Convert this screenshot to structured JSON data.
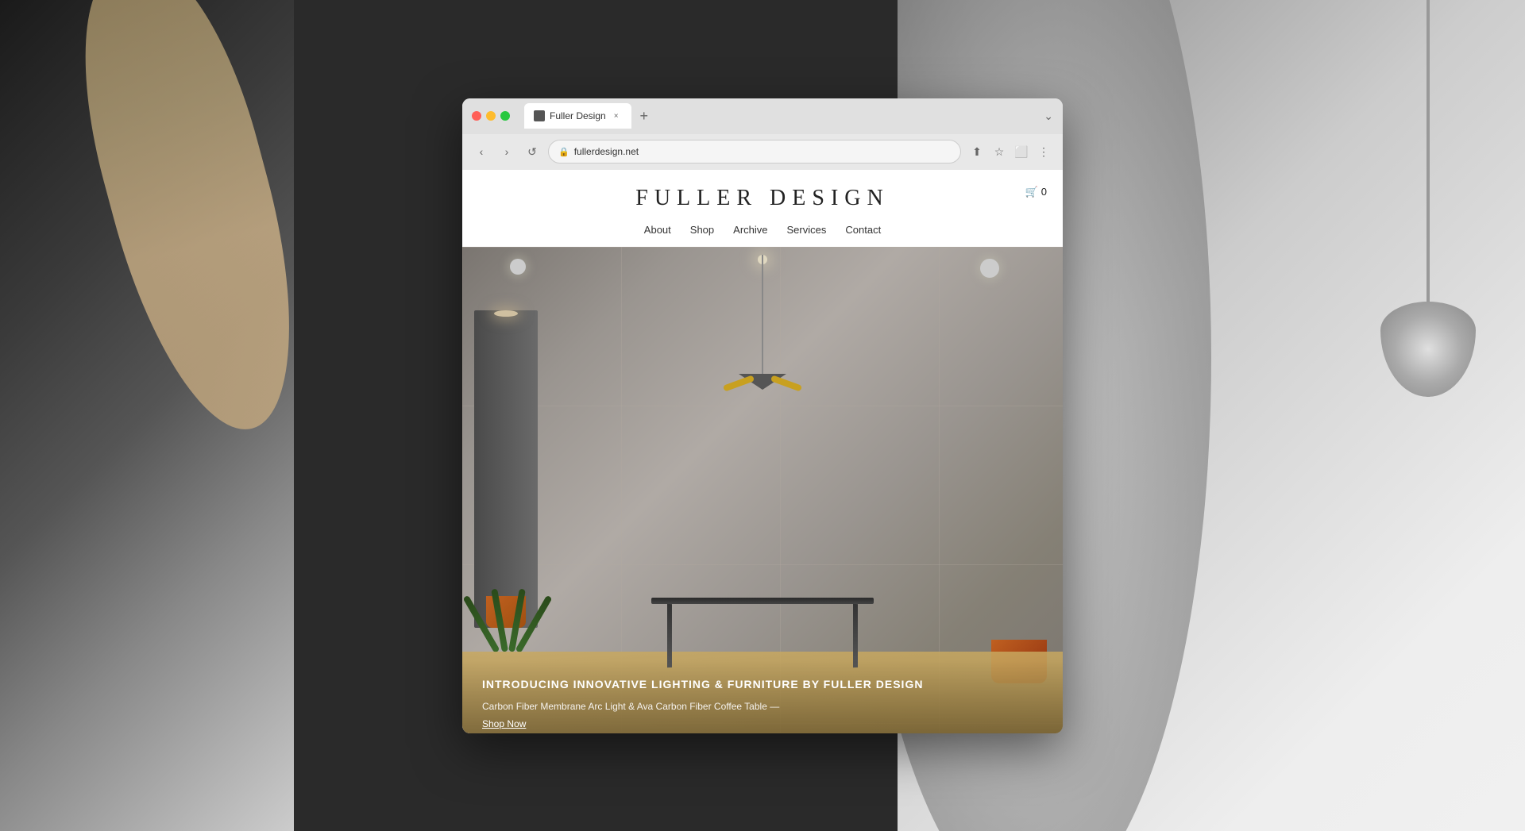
{
  "browser": {
    "tab_title": "Fuller Design",
    "tab_favicon": "F",
    "url": "fullerdesign.net",
    "tab_close": "×",
    "tab_new": "+",
    "tab_dropdown": "⌄",
    "nav_back": "‹",
    "nav_forward": "›",
    "nav_refresh": "↺",
    "nav_share": "⬆",
    "nav_bookmark": "☆",
    "nav_sidebar": "⬜",
    "nav_more": "⋮",
    "cart_count": "0"
  },
  "site": {
    "logo": "FULLER DESIGN",
    "nav": {
      "about": "About",
      "shop": "Shop",
      "archive": "Archive",
      "services": "Services",
      "contact": "Contact"
    },
    "cart_icon": "🛒",
    "hero": {
      "headline": "INTRODUCING INNOVATIVE LIGHTING & FURNITURE BY FULLER DESIGN",
      "subtext": "Carbon Fiber Membrane Arc Light & Ava Carbon Fiber Coffee Table —",
      "shop_now": "Shop Now"
    }
  }
}
